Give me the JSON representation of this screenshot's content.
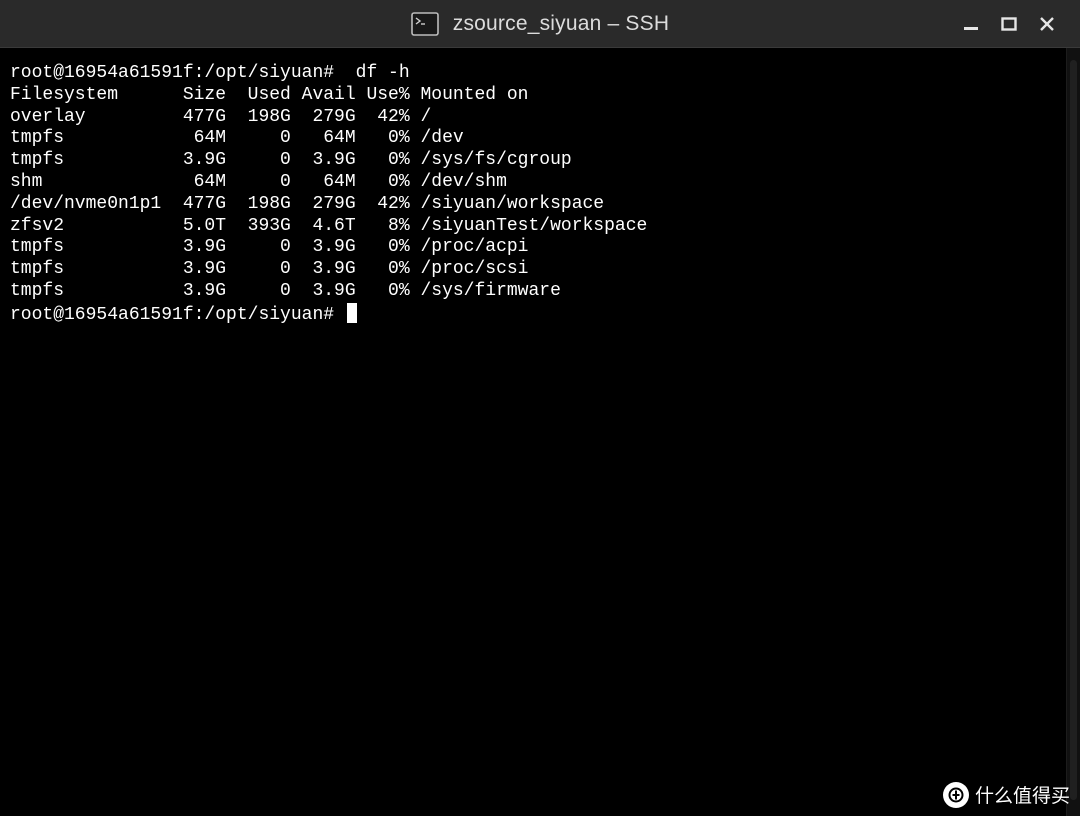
{
  "window": {
    "title": "zsource_siyuan – SSH"
  },
  "terminal": {
    "lines": [
      "root@16954a61591f:/opt/siyuan#  df -h",
      "Filesystem      Size  Used Avail Use% Mounted on",
      "overlay         477G  198G  279G  42% /",
      "tmpfs            64M     0   64M   0% /dev",
      "tmpfs           3.9G     0  3.9G   0% /sys/fs/cgroup",
      "shm              64M     0   64M   0% /dev/shm",
      "/dev/nvme0n1p1  477G  198G  279G  42% /siyuan/workspace",
      "zfsv2           5.0T  393G  4.6T   8% /siyuanTest/workspace",
      "tmpfs           3.9G     0  3.9G   0% /proc/acpi",
      "tmpfs           3.9G     0  3.9G   0% /proc/scsi",
      "tmpfs           3.9G     0  3.9G   0% /sys/firmware"
    ],
    "prompt": "root@16954a61591f:/opt/siyuan# "
  },
  "watermark": {
    "text": "什么值得买"
  },
  "icons": {
    "app": "terminal-icon",
    "minimize": "minimize-icon",
    "maximize": "maximize-icon",
    "close": "close-icon",
    "watermark": "watermark-logo"
  },
  "colors": {
    "background": "#000000",
    "titlebar": "#2a2a2a",
    "text": "#ffffff"
  }
}
